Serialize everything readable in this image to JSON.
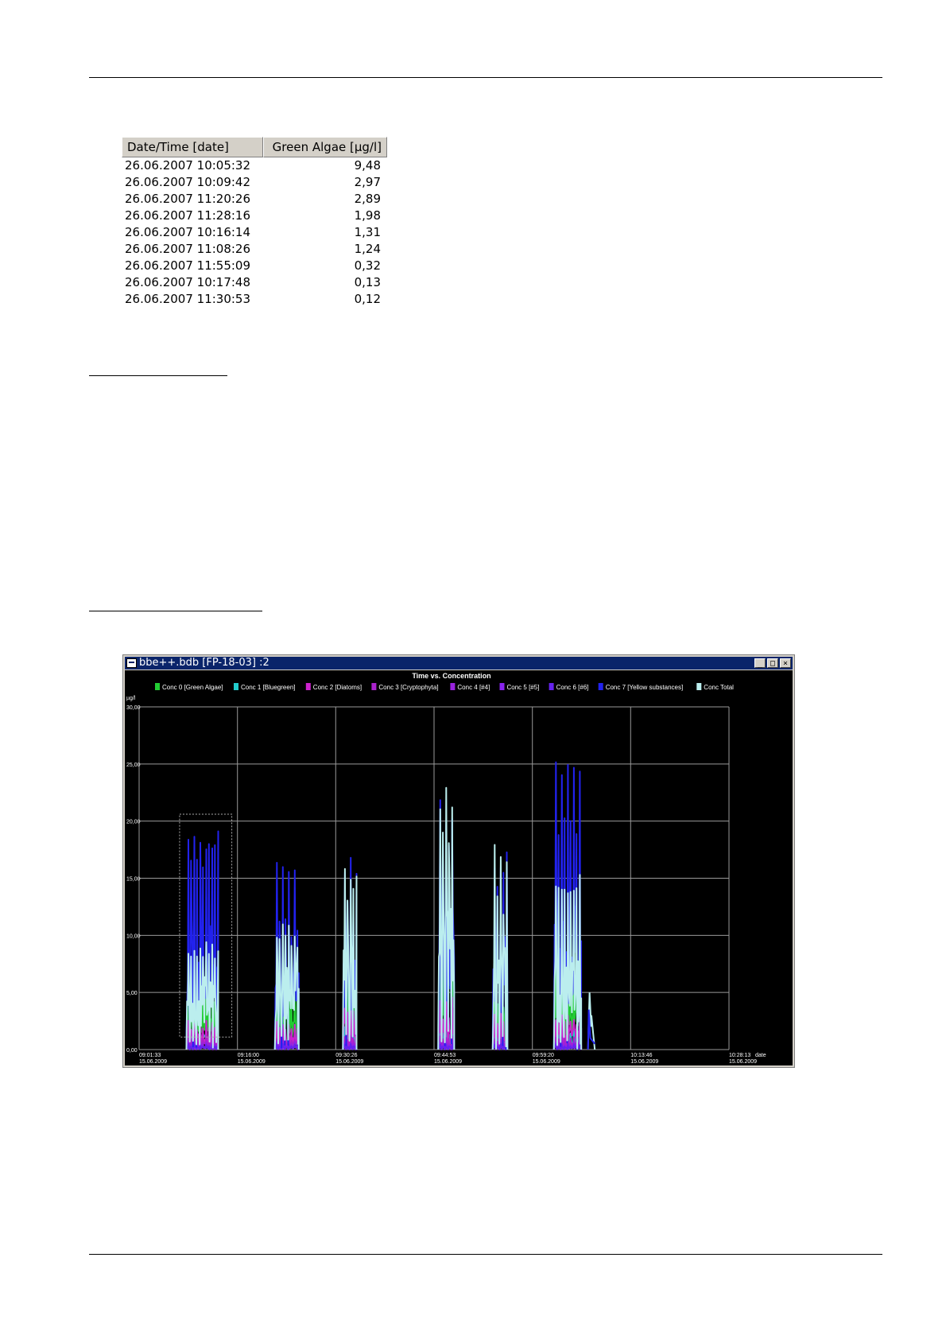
{
  "table": {
    "headers": [
      "Date/Time [date]",
      "Green Algae [µg/l]"
    ],
    "rows": [
      [
        "26.06.2007 10:05:32",
        "9,48"
      ],
      [
        "26.06.2007 10:09:42",
        "2,97"
      ],
      [
        "26.06.2007 11:20:26",
        "2,89"
      ],
      [
        "26.06.2007 11:28:16",
        "1,98"
      ],
      [
        "26.06.2007 10:16:14",
        "1,31"
      ],
      [
        "26.06.2007 11:08:26",
        "1,24"
      ],
      [
        "26.06.2007 11:55:09",
        "0,32"
      ],
      [
        "26.06.2007 10:17:48",
        "0,13"
      ],
      [
        "26.06.2007 11:30:53",
        "0,12"
      ]
    ]
  },
  "window": {
    "title": "bbe++.bdb [FP-18-03] :2",
    "minimize": "_",
    "maximize": "□",
    "close": "×"
  },
  "chart_data": {
    "type": "line",
    "title": "Time vs. Concentration",
    "ylabel": "µg/l",
    "xlabel": "date",
    "ylim": [
      0,
      30
    ],
    "yticks": [
      "0,00",
      "5,00",
      "10,00",
      "15,00",
      "20,00",
      "25,00",
      "30,00"
    ],
    "xticks": [
      [
        "09:01:33",
        "15.06.2009"
      ],
      [
        "09:16:00",
        "15.06.2009"
      ],
      [
        "09:30:26",
        "15.06.2009"
      ],
      [
        "09:44:53",
        "15.06.2009"
      ],
      [
        "09:59:20",
        "15.06.2009"
      ],
      [
        "10:13:46",
        "15.06.2009"
      ],
      [
        "10:28:13",
        "15.06.2009"
      ]
    ],
    "grid": true,
    "legend_position": "top",
    "series": [
      {
        "name": "Conc 0 [Green Algae]",
        "color": "#22cc33",
        "bursts": [
          [
            3.0,
            5.0,
            4.2
          ],
          [
            2.6,
            6.5,
            5.5
          ],
          [
            3.5,
            7.0,
            9.0
          ],
          [
            6.0,
            15.0,
            11.0
          ],
          [
            2.5,
            5.5,
            4.0
          ],
          [
            3.0,
            8.5,
            7.5
          ]
        ]
      },
      {
        "name": "Conc 1 [Bluegreen]",
        "color": "#22cccc",
        "bursts": [
          [
            1.0,
            2.0,
            1.5
          ],
          [
            0.8,
            1.8,
            1.5
          ],
          [
            1.0,
            2.0,
            1.5
          ],
          [
            1.0,
            2.0,
            1.5
          ],
          [
            0.8,
            1.6,
            1.2
          ],
          [
            0.8,
            1.8,
            1.5
          ]
        ]
      },
      {
        "name": "Conc 2 [Diatoms]",
        "color": "#cc22cc",
        "bursts": [
          [
            1.2,
            2.6,
            2.0
          ],
          [
            1.0,
            2.5,
            2.0
          ],
          [
            2.0,
            4.5,
            3.5
          ],
          [
            1.5,
            5.0,
            3.0
          ],
          [
            1.5,
            3.5,
            2.5
          ],
          [
            1.5,
            3.0,
            2.5
          ]
        ]
      },
      {
        "name": "Conc 3 [Cryptophyta]",
        "color": "#aa22cc",
        "bursts": [
          [
            0.5,
            1.2,
            1.0
          ],
          [
            0.5,
            1.0,
            0.8
          ],
          [
            0.5,
            1.2,
            1.0
          ],
          [
            0.5,
            1.2,
            1.0
          ],
          [
            0.4,
            1.0,
            0.8
          ],
          [
            0.5,
            1.2,
            1.0
          ]
        ]
      },
      {
        "name": "Conc 4 [#4]",
        "color": "#9922dd",
        "bursts": [
          [
            0.3,
            0.8,
            0.6
          ],
          [
            0.3,
            0.8,
            0.6
          ],
          [
            0.3,
            0.8,
            0.6
          ],
          [
            0.3,
            0.8,
            0.6
          ],
          [
            0.3,
            0.8,
            0.6
          ],
          [
            0.3,
            0.8,
            0.6
          ]
        ]
      },
      {
        "name": "Conc 5 [#5]",
        "color": "#8822ee",
        "bursts": [
          [
            0.2,
            0.6,
            0.4
          ],
          [
            0.2,
            0.6,
            0.4
          ],
          [
            0.2,
            0.6,
            0.4
          ],
          [
            0.2,
            0.6,
            0.4
          ],
          [
            0.2,
            0.6,
            0.4
          ],
          [
            0.2,
            0.6,
            0.4
          ]
        ]
      },
      {
        "name": "Conc 6 [#6]",
        "color": "#6622ee",
        "bursts": [
          [
            0.2,
            0.5,
            0.3
          ],
          [
            0.2,
            0.5,
            0.3
          ],
          [
            0.2,
            0.5,
            0.3
          ],
          [
            0.2,
            0.5,
            0.3
          ],
          [
            0.2,
            0.5,
            0.3
          ],
          [
            0.2,
            0.5,
            0.3
          ]
        ]
      },
      {
        "name": "Conc 7 [Yellow substances]",
        "color": "#2222ee",
        "bursts": [
          [
            9.0,
            19.5,
            18.5
          ],
          [
            7.0,
            16.5,
            11.5
          ],
          [
            7.0,
            17.5,
            13.5
          ],
          [
            10.0,
            23.0,
            21.0
          ],
          [
            8.0,
            18.0,
            16.0
          ],
          [
            10.0,
            28.0,
            22.0
          ]
        ]
      },
      {
        "name": "Conc Total",
        "color": "#bbeeee",
        "bursts": [
          [
            5.0,
            9.5,
            8.5
          ],
          [
            6.0,
            11.0,
            10.5
          ],
          [
            8.0,
            17.0,
            15.0
          ],
          [
            12.0,
            23.5,
            20.0
          ],
          [
            7.0,
            18.0,
            13.5
          ],
          [
            6.0,
            16.0,
            15.5
          ]
        ]
      }
    ],
    "burst_times": [
      [
        "09:08:30",
        "09:13:10"
      ],
      [
        "09:21:30",
        "09:25:00"
      ],
      [
        "09:31:30",
        "09:33:30"
      ],
      [
        "09:45:30",
        "09:47:50"
      ],
      [
        "09:53:30",
        "09:55:40"
      ],
      [
        "10:02:30",
        "10:06:30"
      ],
      [
        "10:07:30",
        "10:08:30"
      ]
    ]
  }
}
